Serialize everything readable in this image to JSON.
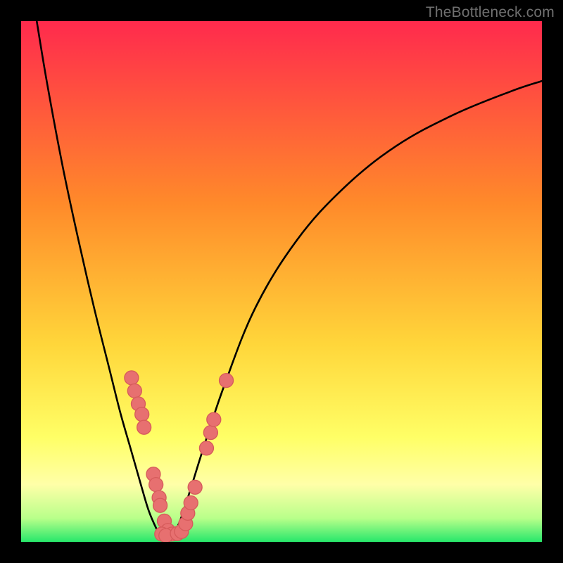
{
  "watermark": "TheBottleneck.com",
  "colors": {
    "frame": "#000000",
    "curve": "#000000",
    "dot_fill": "#e77070",
    "dot_stroke": "#d65b5b",
    "grad_top": "#ff2a4d",
    "grad_mid1": "#ff8a2a",
    "grad_mid2": "#ffd63a",
    "grad_yellow": "#ffff66",
    "grad_pale": "#ffffa8",
    "grad_green_light": "#b8ff8a",
    "grad_green": "#27e76b"
  },
  "chart_data": {
    "type": "line",
    "title": "",
    "xlabel": "",
    "ylabel": "",
    "xlim": [
      0,
      100
    ],
    "ylim": [
      0,
      100
    ],
    "series": [
      {
        "name": "bottleneck-curve-left",
        "x": [
          3,
          5,
          8,
          11,
          14,
          17,
          19,
          21,
          23,
          24.5,
          26,
          27,
          28
        ],
        "y": [
          100,
          88,
          72,
          58,
          45,
          33,
          25,
          18,
          11,
          6,
          2.5,
          0.8,
          0
        ]
      },
      {
        "name": "bottleneck-curve-right",
        "x": [
          28,
          29,
          30.5,
          32.5,
          35,
          39,
          45,
          53,
          62,
          72,
          83,
          94,
          100
        ],
        "y": [
          0,
          1,
          4,
          10,
          18,
          30,
          45,
          58,
          68,
          76,
          82,
          86.5,
          88.5
        ]
      }
    ],
    "points": [
      {
        "x": 21.2,
        "y": 31.5
      },
      {
        "x": 21.8,
        "y": 29.0
      },
      {
        "x": 22.5,
        "y": 26.5
      },
      {
        "x": 23.2,
        "y": 24.5
      },
      {
        "x": 23.6,
        "y": 22.0
      },
      {
        "x": 25.4,
        "y": 13.0
      },
      {
        "x": 25.9,
        "y": 11.0
      },
      {
        "x": 26.5,
        "y": 8.5
      },
      {
        "x": 26.7,
        "y": 7.0
      },
      {
        "x": 27.5,
        "y": 4.0
      },
      {
        "x": 28.2,
        "y": 2.2
      },
      {
        "x": 29.0,
        "y": 1.5
      },
      {
        "x": 27.0,
        "y": 1.5
      },
      {
        "x": 27.8,
        "y": 1.2
      },
      {
        "x": 30.0,
        "y": 1.6
      },
      {
        "x": 30.8,
        "y": 2.0
      },
      {
        "x": 31.6,
        "y": 3.5
      },
      {
        "x": 32.0,
        "y": 5.5
      },
      {
        "x": 32.6,
        "y": 7.5
      },
      {
        "x": 33.4,
        "y": 10.5
      },
      {
        "x": 35.6,
        "y": 18.0
      },
      {
        "x": 36.4,
        "y": 21.0
      },
      {
        "x": 37.0,
        "y": 23.5
      },
      {
        "x": 39.4,
        "y": 31.0
      }
    ],
    "dot_radius": 1.35
  }
}
